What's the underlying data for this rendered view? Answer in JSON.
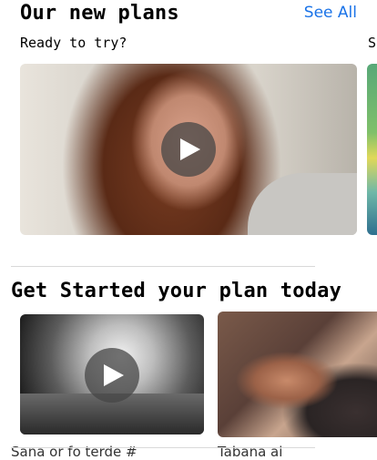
{
  "plans_section": {
    "title": "Our new plans",
    "see_all": "See All",
    "subtitle": "Ready to try?",
    "subtitle_next": "St"
  },
  "get_started_section": {
    "title": "Get Started your plan today",
    "captions": [
      "Sana or fo terde #",
      "Tabana ai"
    ]
  },
  "colors": {
    "accent_link": "#1a73e8",
    "play_button_overlay": "#464646"
  }
}
